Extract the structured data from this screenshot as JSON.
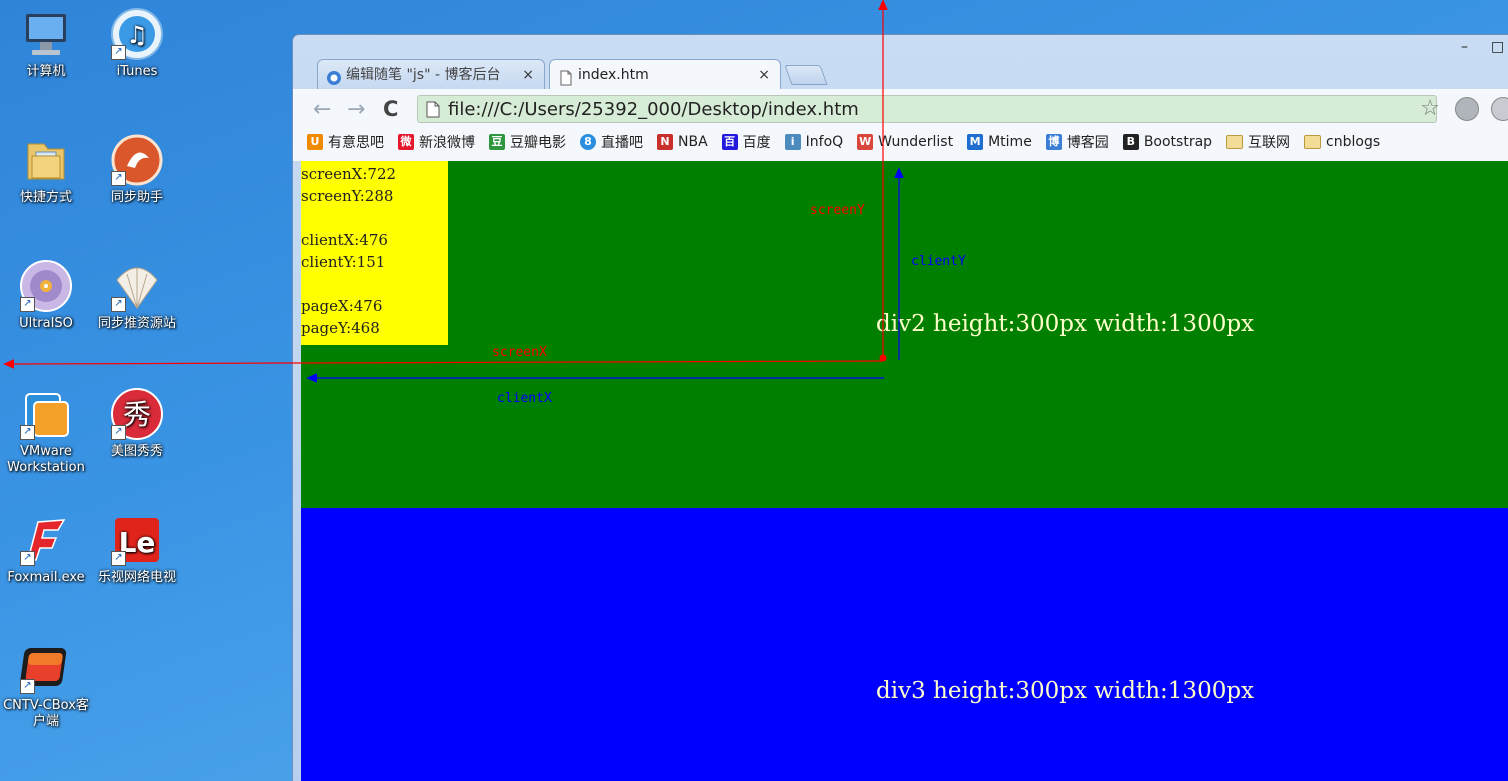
{
  "desktop": {
    "icons": [
      {
        "label": "计算机",
        "icon": "computer-icon"
      },
      {
        "label": "iTunes",
        "icon": "itunes-icon"
      },
      {
        "label": "快捷方式",
        "icon": "folder-shortcut-icon"
      },
      {
        "label": "同步助手",
        "icon": "tongbu-icon"
      },
      {
        "label": "UltraISO",
        "icon": "ultraiso-icon"
      },
      {
        "label": "同步推资源站",
        "icon": "shell-icon"
      },
      {
        "label": "VMware Workstation",
        "icon": "vmware-icon"
      },
      {
        "label": "美图秀秀",
        "icon": "meitu-icon"
      },
      {
        "label": "Foxmail.exe",
        "icon": "foxmail-icon"
      },
      {
        "label": "乐视网络电视",
        "icon": "letv-icon"
      },
      {
        "label": "CNTV-CBox客户端",
        "icon": "cbox-icon"
      }
    ]
  },
  "browser": {
    "window_controls": {
      "minimize": "–",
      "maximize": "□"
    },
    "tabs": [
      {
        "title": "编辑随笔 \"js\" - 博客后台",
        "icon": "cnblogs-icon",
        "close": "×"
      },
      {
        "title": "index.htm",
        "icon": "page-icon",
        "close": "×"
      }
    ],
    "nav": {
      "back": "←",
      "forward": "→",
      "reload": "C"
    },
    "address": "file:///C:/Users/25392_000/Desktop/index.htm",
    "star": "☆",
    "bookmarks": [
      {
        "label": "有意思吧",
        "color": "#f08a00"
      },
      {
        "label": "新浪微博",
        "color": "#e6162d"
      },
      {
        "label": "豆瓣电影",
        "color": "#2e963d"
      },
      {
        "label": "直播吧",
        "color": "#2a8ee0"
      },
      {
        "label": "NBA",
        "color": "#c9302c"
      },
      {
        "label": "百度",
        "color": "#2319dc"
      },
      {
        "label": "InfoQ",
        "color": "#4b8bbe"
      },
      {
        "label": "Wunderlist",
        "color": "#d9463b"
      },
      {
        "label": "Mtime",
        "color": "#1f6fd0"
      },
      {
        "label": "博客园",
        "color": "#3a7fd5"
      },
      {
        "label": "Bootstrap",
        "color": "#222222"
      },
      {
        "label": "互联网",
        "color": "#e8c35e"
      },
      {
        "label": "cnblogs",
        "color": "#e8c35e"
      }
    ]
  },
  "page": {
    "info": {
      "screenX": "screenX:722",
      "screenY": "screenY:288",
      "clientX": "clientX:476",
      "clientY": "clientY:151",
      "pageX": "pageX:476",
      "pageY": "pageY:468"
    },
    "div2_label": "div2 height:300px width:1300px",
    "div3_label": "div3 height:300px width:1300px",
    "div2_color": "#007f00",
    "div3_color": "#0000ff",
    "info_color": "#ffff00"
  },
  "annotations": {
    "screenX": "screenX",
    "screenY": "screenY",
    "clientX": "clientX",
    "clientY": "clientY",
    "screen_color": "#ff0000",
    "client_color": "#0000ff"
  }
}
